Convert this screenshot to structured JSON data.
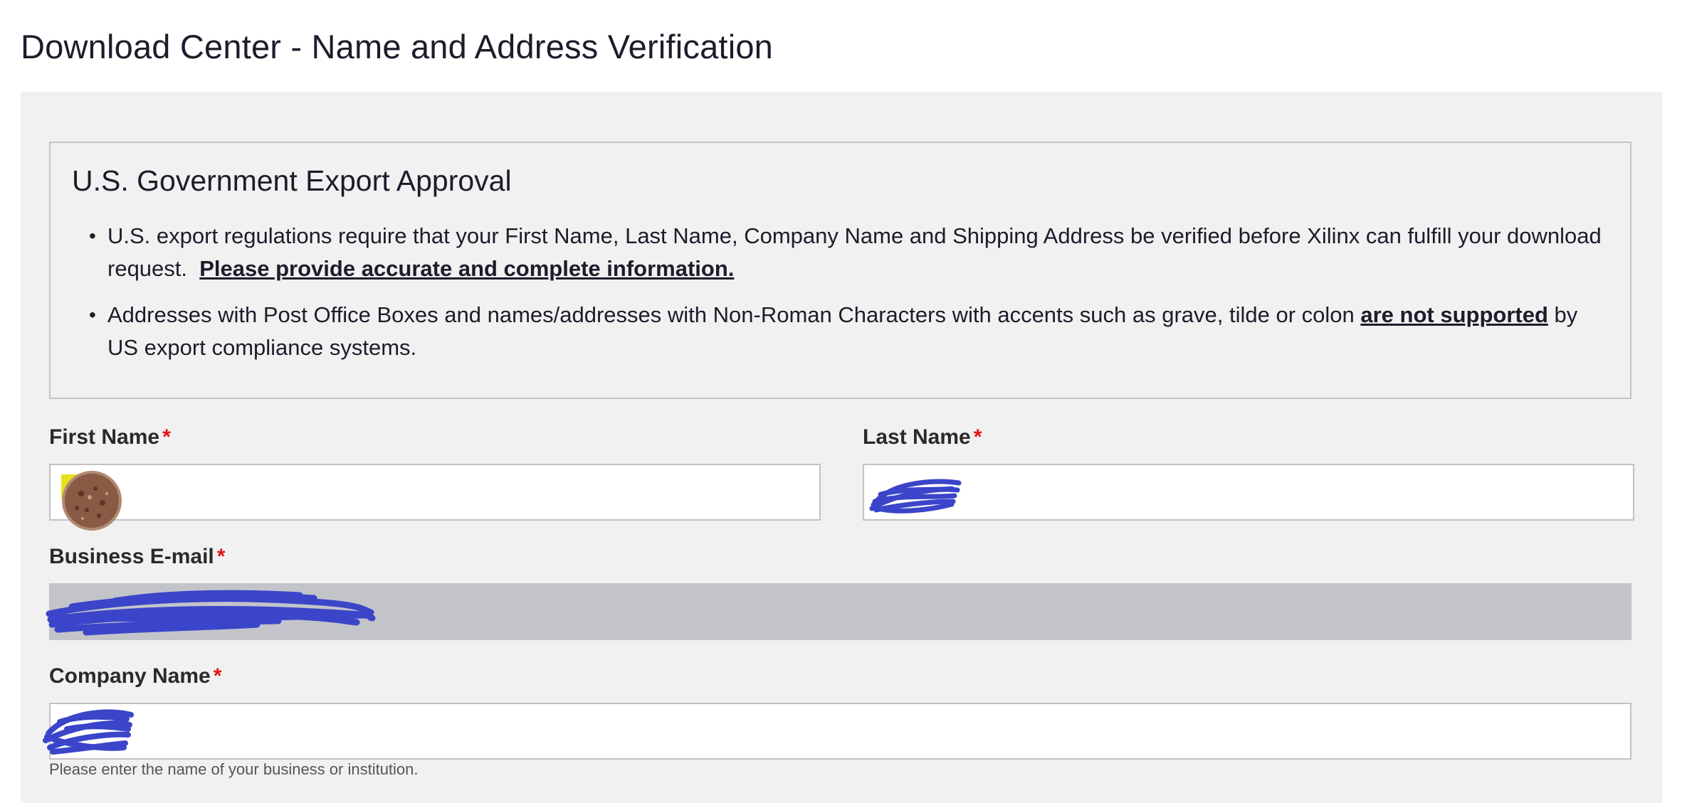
{
  "page": {
    "title": "Download Center - Name and Address Verification"
  },
  "notice": {
    "title": "U.S. Government Export Approval",
    "bullet1_text": "U.S. export regulations require that your First Name, Last Name, Company Name and Shipping Address be verified before Xilinx can fulfill your download request.",
    "bullet1_emphasis": "Please provide accurate and complete information.",
    "bullet2_text_before": "Addresses with Post Office Boxes and names/addresses with Non-Roman Characters with accents such as grave, tilde or colon ",
    "bullet2_emphasis": "are not supported",
    "bullet2_text_after": " by US export compliance systems."
  },
  "form": {
    "first_name": {
      "label": "First Name",
      "required_marker": "*",
      "value": "",
      "redaction_icon": "scribble-avatar-icon"
    },
    "last_name": {
      "label": "Last Name",
      "required_marker": "*",
      "value": "",
      "redaction_icon": "scribble-redaction-icon"
    },
    "business_email": {
      "label": "Business E-mail",
      "required_marker": "*",
      "value": "",
      "readonly": true,
      "redaction_icon": "scribble-redaction-icon"
    },
    "company_name": {
      "label": "Company Name",
      "required_marker": "*",
      "value": "",
      "help_text": "Please enter the name of your business or institution.",
      "redaction_icon": "scribble-redaction-icon"
    }
  },
  "colors": {
    "panel_background": "#f1f1f1",
    "required_marker": "#e0161b",
    "readonly_field": "#c3c4ca",
    "redaction_ink": "#3b45c9"
  }
}
